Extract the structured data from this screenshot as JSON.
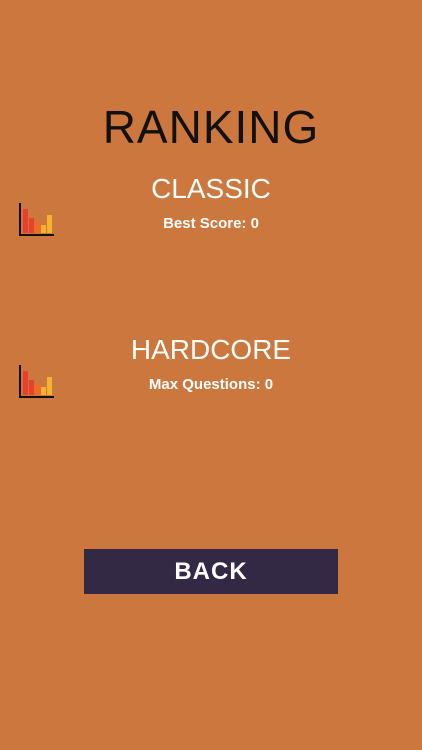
{
  "screen": {
    "title": "RANKING"
  },
  "modes": [
    {
      "name": "CLASSIC",
      "stat_label": "Best Score: 0",
      "icon": "bar-chart-icon"
    },
    {
      "name": "HARDCORE",
      "stat_label": "Max Questions: 0",
      "icon": "bar-chart-icon"
    }
  ],
  "back_button": {
    "label": "BACK"
  },
  "colors": {
    "background": "#CC773D",
    "title_text": "#111111",
    "button_bg": "#332945",
    "icon_bar_red": "#E8402A",
    "icon_bar_orange": "#F06A24",
    "icon_bar_yellow": "#F5B22E"
  }
}
